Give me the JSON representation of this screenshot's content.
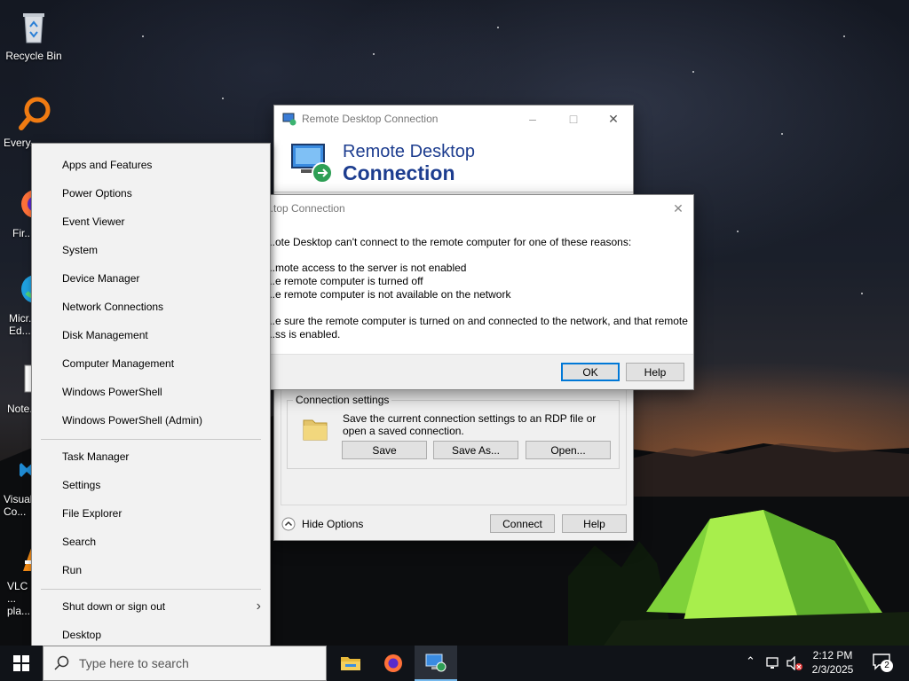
{
  "desktop": {
    "icons": [
      {
        "label": "Recycle Bin",
        "icon": "recycle-bin-icon"
      },
      {
        "label": "Every...",
        "icon": "everything-search-icon"
      },
      {
        "label": "Fir...",
        "icon": "firefox-icon"
      },
      {
        "label": "Micr... Ed...",
        "icon": "edge-icon"
      },
      {
        "label": "Note...",
        "icon": "notepad-plus-icon"
      },
      {
        "label": "Visual... Co...",
        "icon": "vscode-icon"
      },
      {
        "label": "VLC ... pla...",
        "icon": "vlc-icon"
      }
    ]
  },
  "rdp_window": {
    "title": "Remote Desktop Connection",
    "banner_line1": "Remote Desktop",
    "banner_line2": "Connection",
    "connection_settings": {
      "legend": "Connection settings",
      "description": "Save the current connection settings to an RDP file or open a saved connection.",
      "save": "Save",
      "save_as": "Save As...",
      "open": "Open..."
    },
    "hide_options": "Hide Options",
    "connect": "Connect",
    "help": "Help"
  },
  "error_dialog": {
    "title": "...top Connection",
    "intro": "...ote Desktop can't connect to the remote computer for one of these reasons:",
    "reasons": [
      "...mote access to the server is not enabled",
      "...e remote computer is turned off",
      "...e remote computer is not available on the network"
    ],
    "advice_line1": "...e sure the remote computer is turned on and connected to the network, and that remote",
    "advice_line2": "...ss is enabled.",
    "ok": "OK",
    "help": "Help"
  },
  "winx_menu": {
    "group1": [
      "Apps and Features",
      "Power Options",
      "Event Viewer",
      "System",
      "Device Manager",
      "Network Connections",
      "Disk Management",
      "Computer Management",
      "Windows PowerShell",
      "Windows PowerShell (Admin)"
    ],
    "group2": [
      "Task Manager",
      "Settings",
      "File Explorer",
      "Search",
      "Run"
    ],
    "shutdown": "Shut down or sign out",
    "desktop": "Desktop"
  },
  "taskbar": {
    "search_placeholder": "Type here to search",
    "apps": [
      "file-explorer-icon",
      "firefox-icon",
      "remote-desktop-icon"
    ],
    "time": "2:12 PM",
    "date": "2/3/2025",
    "notification_count": "2"
  },
  "colors": {
    "rdp_title_blue": "#1d3d8f",
    "ok_border": "#0078d7",
    "taskbar": "#101318"
  }
}
